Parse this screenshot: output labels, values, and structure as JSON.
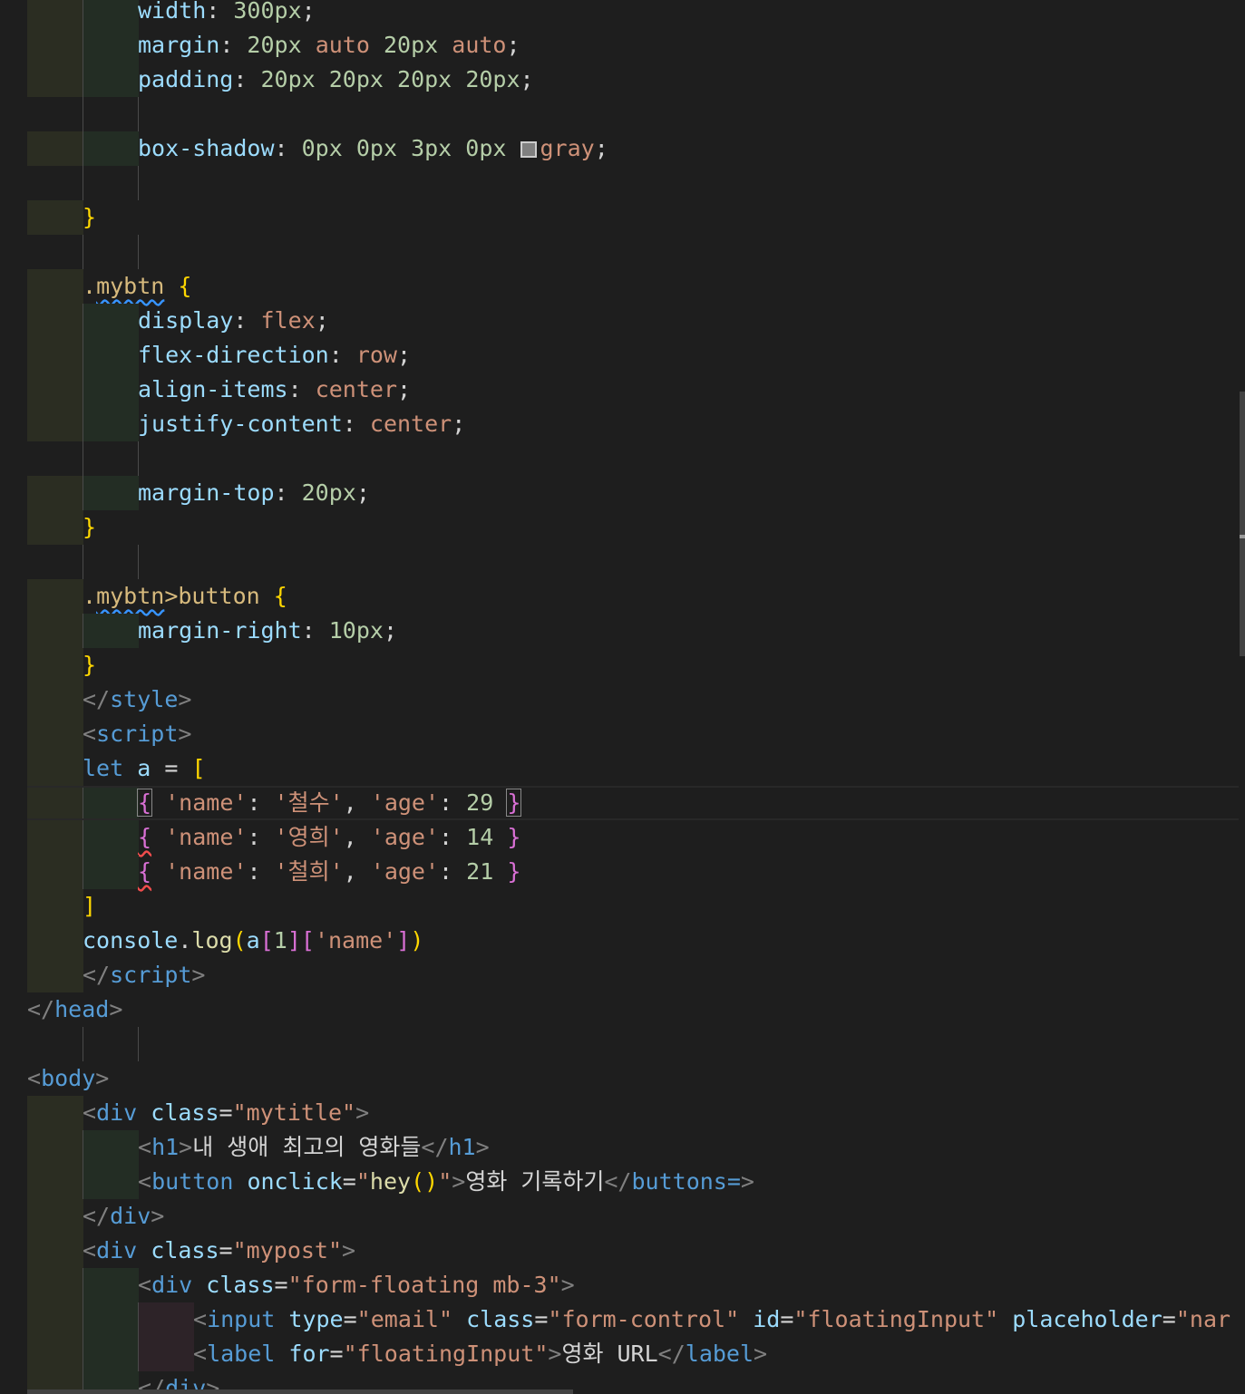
{
  "editor": {
    "lines": [
      {
        "indent": 2,
        "tokens": [
          {
            "c": "a",
            "t": "width"
          },
          {
            "c": "p",
            "t": ": "
          },
          {
            "c": "n",
            "t": "300px"
          },
          {
            "c": "p",
            "t": ";"
          }
        ]
      },
      {
        "indent": 2,
        "tokens": [
          {
            "c": "a",
            "t": "margin"
          },
          {
            "c": "p",
            "t": ": "
          },
          {
            "c": "n",
            "t": "20px"
          },
          {
            "c": "p",
            "t": " "
          },
          {
            "c": "s",
            "t": "auto"
          },
          {
            "c": "p",
            "t": " "
          },
          {
            "c": "n",
            "t": "20px"
          },
          {
            "c": "p",
            "t": " "
          },
          {
            "c": "s",
            "t": "auto"
          },
          {
            "c": "p",
            "t": ";"
          }
        ]
      },
      {
        "indent": 2,
        "tokens": [
          {
            "c": "a",
            "t": "padding"
          },
          {
            "c": "p",
            "t": ": "
          },
          {
            "c": "n",
            "t": "20px"
          },
          {
            "c": "p",
            "t": " "
          },
          {
            "c": "n",
            "t": "20px"
          },
          {
            "c": "p",
            "t": " "
          },
          {
            "c": "n",
            "t": "20px"
          },
          {
            "c": "p",
            "t": " "
          },
          {
            "c": "n",
            "t": "20px"
          },
          {
            "c": "p",
            "t": ";"
          }
        ]
      },
      {
        "indent": 0,
        "tokens": []
      },
      {
        "indent": 2,
        "tokens": [
          {
            "c": "a",
            "t": "box-shadow"
          },
          {
            "c": "p",
            "t": ": "
          },
          {
            "c": "n",
            "t": "0px"
          },
          {
            "c": "p",
            "t": " "
          },
          {
            "c": "n",
            "t": "0px"
          },
          {
            "c": "p",
            "t": " "
          },
          {
            "c": "n",
            "t": "3px"
          },
          {
            "c": "p",
            "t": " "
          },
          {
            "c": "n",
            "t": "0px"
          },
          {
            "c": "p",
            "t": " "
          },
          {
            "c": "swatch",
            "t": ""
          },
          {
            "c": "s",
            "t": "gray"
          },
          {
            "c": "p",
            "t": ";"
          }
        ]
      },
      {
        "indent": 0,
        "tokens": []
      },
      {
        "indent": 1,
        "tokens": [
          {
            "c": "y",
            "t": "}"
          }
        ]
      },
      {
        "indent": 0,
        "tokens": []
      },
      {
        "indent": 1,
        "tokens": [
          {
            "c": "sel",
            "t": "."
          },
          {
            "c": "sel squig",
            "t": "mybtn"
          },
          {
            "c": "p",
            "t": " "
          },
          {
            "c": "y",
            "t": "{"
          }
        ]
      },
      {
        "indent": 2,
        "tokens": [
          {
            "c": "a",
            "t": "display"
          },
          {
            "c": "p",
            "t": ": "
          },
          {
            "c": "s",
            "t": "flex"
          },
          {
            "c": "p",
            "t": ";"
          }
        ]
      },
      {
        "indent": 2,
        "tokens": [
          {
            "c": "a",
            "t": "flex-direction"
          },
          {
            "c": "p",
            "t": ": "
          },
          {
            "c": "s",
            "t": "row"
          },
          {
            "c": "p",
            "t": ";"
          }
        ]
      },
      {
        "indent": 2,
        "tokens": [
          {
            "c": "a",
            "t": "align-items"
          },
          {
            "c": "p",
            "t": ": "
          },
          {
            "c": "s",
            "t": "center"
          },
          {
            "c": "p",
            "t": ";"
          }
        ]
      },
      {
        "indent": 2,
        "tokens": [
          {
            "c": "a",
            "t": "justify-content"
          },
          {
            "c": "p",
            "t": ": "
          },
          {
            "c": "s",
            "t": "center"
          },
          {
            "c": "p",
            "t": ";"
          }
        ]
      },
      {
        "indent": 0,
        "tokens": []
      },
      {
        "indent": 2,
        "tokens": [
          {
            "c": "a",
            "t": "margin-top"
          },
          {
            "c": "p",
            "t": ": "
          },
          {
            "c": "n",
            "t": "20px"
          },
          {
            "c": "p",
            "t": ";"
          }
        ]
      },
      {
        "indent": 1,
        "tokens": [
          {
            "c": "y",
            "t": "}"
          }
        ]
      },
      {
        "indent": 0,
        "tokens": []
      },
      {
        "indent": 1,
        "tokens": [
          {
            "c": "sel",
            "t": "."
          },
          {
            "c": "sel squig",
            "t": "mybtn"
          },
          {
            "c": "sel",
            "t": ">button"
          },
          {
            "c": "p",
            "t": " "
          },
          {
            "c": "y",
            "t": "{"
          }
        ]
      },
      {
        "indent": 2,
        "tokens": [
          {
            "c": "a",
            "t": "margin-right"
          },
          {
            "c": "p",
            "t": ": "
          },
          {
            "c": "n",
            "t": "10px"
          },
          {
            "c": "p",
            "t": ";"
          }
        ]
      },
      {
        "indent": 1,
        "tokens": [
          {
            "c": "y",
            "t": "}"
          }
        ]
      },
      {
        "indent": 1,
        "tokens": [
          {
            "c": "b",
            "t": "</"
          },
          {
            "c": "t",
            "t": "style"
          },
          {
            "c": "b",
            "t": ">"
          }
        ],
        "outdent": 1
      },
      {
        "indent": 1,
        "tokens": [
          {
            "c": "b",
            "t": "<"
          },
          {
            "c": "t",
            "t": "script"
          },
          {
            "c": "b",
            "t": ">"
          }
        ],
        "outdent": 1
      },
      {
        "indent": 1,
        "tokens": [
          {
            "c": "k",
            "t": "let"
          },
          {
            "c": "p",
            "t": " "
          },
          {
            "c": "v",
            "t": "a"
          },
          {
            "c": "p",
            "t": " = "
          },
          {
            "c": "y",
            "t": "["
          }
        ]
      },
      {
        "indent": 2,
        "current": true,
        "tokens": [
          {
            "c": "m bm",
            "t": "{"
          },
          {
            "c": "p",
            "t": " "
          },
          {
            "c": "s",
            "t": "'name'"
          },
          {
            "c": "p",
            "t": ": "
          },
          {
            "c": "s",
            "t": "'철수'"
          },
          {
            "c": "p",
            "t": ", "
          },
          {
            "c": "s",
            "t": "'age'"
          },
          {
            "c": "p",
            "t": ": "
          },
          {
            "c": "n",
            "t": "29"
          },
          {
            "c": "p",
            "t": " "
          },
          {
            "c": "m bm",
            "t": "}"
          }
        ]
      },
      {
        "indent": 2,
        "tokens": [
          {
            "c": "m squig-r",
            "t": "{"
          },
          {
            "c": "p",
            "t": " "
          },
          {
            "c": "s",
            "t": "'name'"
          },
          {
            "c": "p",
            "t": ": "
          },
          {
            "c": "s",
            "t": "'영희'"
          },
          {
            "c": "p",
            "t": ", "
          },
          {
            "c": "s",
            "t": "'age'"
          },
          {
            "c": "p",
            "t": ": "
          },
          {
            "c": "n",
            "t": "14"
          },
          {
            "c": "p",
            "t": " "
          },
          {
            "c": "m",
            "t": "}"
          }
        ]
      },
      {
        "indent": 2,
        "tokens": [
          {
            "c": "m squig-r",
            "t": "{"
          },
          {
            "c": "p",
            "t": " "
          },
          {
            "c": "s",
            "t": "'name'"
          },
          {
            "c": "p",
            "t": ": "
          },
          {
            "c": "s",
            "t": "'철희'"
          },
          {
            "c": "p",
            "t": ", "
          },
          {
            "c": "s",
            "t": "'age'"
          },
          {
            "c": "p",
            "t": ": "
          },
          {
            "c": "n",
            "t": "21"
          },
          {
            "c": "p",
            "t": " "
          },
          {
            "c": "m",
            "t": "}"
          }
        ]
      },
      {
        "indent": 1,
        "tokens": [
          {
            "c": "y",
            "t": "]"
          }
        ]
      },
      {
        "indent": 1,
        "tokens": [
          {
            "c": "v",
            "t": "console"
          },
          {
            "c": "p",
            "t": "."
          },
          {
            "c": "f",
            "t": "log"
          },
          {
            "c": "y",
            "t": "("
          },
          {
            "c": "v",
            "t": "a"
          },
          {
            "c": "m",
            "t": "["
          },
          {
            "c": "n",
            "t": "1"
          },
          {
            "c": "m",
            "t": "]["
          },
          {
            "c": "s",
            "t": "'name'"
          },
          {
            "c": "m",
            "t": "]"
          },
          {
            "c": "y",
            "t": ")"
          }
        ]
      },
      {
        "indent": 1,
        "tokens": [
          {
            "c": "b",
            "t": "</"
          },
          {
            "c": "t",
            "t": "script"
          },
          {
            "c": "b",
            "t": ">"
          }
        ],
        "outdent": 1
      },
      {
        "indent": 0,
        "tokens": [
          {
            "c": "b",
            "t": "</"
          },
          {
            "c": "t",
            "t": "head"
          },
          {
            "c": "b",
            "t": ">"
          }
        ]
      },
      {
        "indent": 0,
        "tokens": []
      },
      {
        "indent": 0,
        "tokens": [
          {
            "c": "b",
            "t": "<"
          },
          {
            "c": "t",
            "t": "body"
          },
          {
            "c": "b",
            "t": ">"
          }
        ]
      },
      {
        "indent": 1,
        "tokens": [
          {
            "c": "b",
            "t": "<"
          },
          {
            "c": "t",
            "t": "div"
          },
          {
            "c": "p",
            "t": " "
          },
          {
            "c": "a",
            "t": "class"
          },
          {
            "c": "p",
            "t": "="
          },
          {
            "c": "s",
            "t": "\"mytitle\""
          },
          {
            "c": "b",
            "t": ">"
          }
        ],
        "outdent": 1
      },
      {
        "indent": 2,
        "tokens": [
          {
            "c": "b",
            "t": "<"
          },
          {
            "c": "t",
            "t": "h1"
          },
          {
            "c": "b",
            "t": ">"
          },
          {
            "c": "p",
            "t": "내 생애 최고의 영화들"
          },
          {
            "c": "b",
            "t": "</"
          },
          {
            "c": "t",
            "t": "h1"
          },
          {
            "c": "b",
            "t": ">"
          }
        ],
        "outdent": 1
      },
      {
        "indent": 2,
        "tokens": [
          {
            "c": "b",
            "t": "<"
          },
          {
            "c": "t",
            "t": "button"
          },
          {
            "c": "p",
            "t": " "
          },
          {
            "c": "a",
            "t": "onclick"
          },
          {
            "c": "p",
            "t": "="
          },
          {
            "c": "s",
            "t": "\""
          },
          {
            "c": "f",
            "t": "hey"
          },
          {
            "c": "y",
            "t": "()"
          },
          {
            "c": "s",
            "t": "\""
          },
          {
            "c": "b",
            "t": ">"
          },
          {
            "c": "p",
            "t": "영화 기록하기"
          },
          {
            "c": "b",
            "t": "</"
          },
          {
            "c": "t",
            "t": "buttons="
          },
          {
            "c": "b",
            "t": ">"
          }
        ],
        "outdent": 1
      },
      {
        "indent": 1,
        "tokens": [
          {
            "c": "b",
            "t": "</"
          },
          {
            "c": "t",
            "t": "div"
          },
          {
            "c": "b",
            "t": ">"
          }
        ],
        "outdent": 1
      },
      {
        "indent": 1,
        "tokens": [
          {
            "c": "b",
            "t": "<"
          },
          {
            "c": "t",
            "t": "div"
          },
          {
            "c": "p",
            "t": " "
          },
          {
            "c": "a",
            "t": "class"
          },
          {
            "c": "p",
            "t": "="
          },
          {
            "c": "s",
            "t": "\"mypost\""
          },
          {
            "c": "b",
            "t": ">"
          }
        ],
        "outdent": 1
      },
      {
        "indent": 2,
        "tokens": [
          {
            "c": "b",
            "t": "<"
          },
          {
            "c": "t",
            "t": "div"
          },
          {
            "c": "p",
            "t": " "
          },
          {
            "c": "a",
            "t": "class"
          },
          {
            "c": "p",
            "t": "="
          },
          {
            "c": "s",
            "t": "\"form-floating mb-3\""
          },
          {
            "c": "b",
            "t": ">"
          }
        ],
        "outdent": 1
      },
      {
        "indent": 3,
        "tokens": [
          {
            "c": "b",
            "t": "<"
          },
          {
            "c": "t",
            "t": "input"
          },
          {
            "c": "p",
            "t": " "
          },
          {
            "c": "a",
            "t": "type"
          },
          {
            "c": "p",
            "t": "="
          },
          {
            "c": "s",
            "t": "\"email\""
          },
          {
            "c": "p",
            "t": " "
          },
          {
            "c": "a",
            "t": "class"
          },
          {
            "c": "p",
            "t": "="
          },
          {
            "c": "s",
            "t": "\"form-control\""
          },
          {
            "c": "p",
            "t": " "
          },
          {
            "c": "a",
            "t": "id"
          },
          {
            "c": "p",
            "t": "="
          },
          {
            "c": "s",
            "t": "\"floatingInput\""
          },
          {
            "c": "p",
            "t": " "
          },
          {
            "c": "a",
            "t": "placeholder"
          },
          {
            "c": "p",
            "t": "="
          },
          {
            "c": "s",
            "t": "\"nar"
          }
        ],
        "outdent": 1
      },
      {
        "indent": 3,
        "tokens": [
          {
            "c": "b",
            "t": "<"
          },
          {
            "c": "t",
            "t": "label"
          },
          {
            "c": "p",
            "t": " "
          },
          {
            "c": "a",
            "t": "for"
          },
          {
            "c": "p",
            "t": "="
          },
          {
            "c": "s",
            "t": "\"floatingInput\""
          },
          {
            "c": "b",
            "t": ">"
          },
          {
            "c": "p",
            "t": "영화 URL"
          },
          {
            "c": "b",
            "t": "</"
          },
          {
            "c": "t",
            "t": "label"
          },
          {
            "c": "b",
            "t": ">"
          }
        ],
        "outdent": 1
      },
      {
        "indent": 2,
        "tokens": [
          {
            "c": "b",
            "t": "</"
          },
          {
            "c": "t",
            "t": "div"
          },
          {
            "c": "b",
            "t": ">"
          }
        ],
        "outdent": 1
      }
    ]
  }
}
